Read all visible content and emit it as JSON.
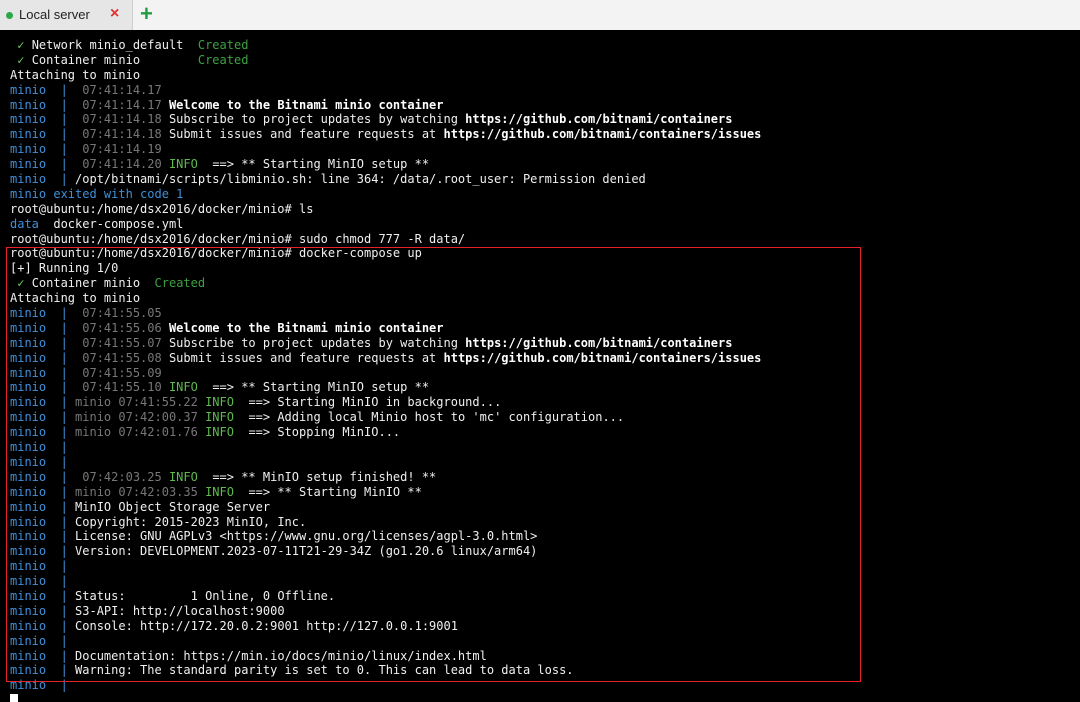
{
  "tab": {
    "title": "Local server",
    "close_icon": "×",
    "add_icon": "+"
  },
  "colors": {
    "highlight_border": "#e8222b",
    "container_prefix": "#3f8fd8",
    "timestamp": "#777777",
    "info": "#5fb94f",
    "created": "#3ea043"
  },
  "terminal": {
    "lines": [
      [
        [
          "check",
          " ✓ "
        ],
        [
          "white",
          "Network minio_default  "
        ],
        [
          "dgreen",
          "Created"
        ]
      ],
      [
        [
          "check",
          " ✓ "
        ],
        [
          "white",
          "Container minio        "
        ],
        [
          "dgreen",
          "Created"
        ]
      ],
      [
        [
          "white",
          "Attaching to minio"
        ]
      ],
      [
        [
          "blue",
          "minio  |  "
        ],
        [
          "dim",
          "07:41:14.17"
        ]
      ],
      [
        [
          "blue",
          "minio  |  "
        ],
        [
          "dim",
          "07:41:14.17 "
        ],
        [
          "bold",
          "Welcome to the Bitnami minio container"
        ]
      ],
      [
        [
          "blue",
          "minio  |  "
        ],
        [
          "dim",
          "07:41:14.18 "
        ],
        [
          "white",
          "Subscribe to project updates by watching "
        ],
        [
          "bold",
          "https://github.com/bitnami/containers"
        ]
      ],
      [
        [
          "blue",
          "minio  |  "
        ],
        [
          "dim",
          "07:41:14.18 "
        ],
        [
          "white",
          "Submit issues and feature requests at "
        ],
        [
          "bold",
          "https://github.com/bitnami/containers/issues"
        ]
      ],
      [
        [
          "blue",
          "minio  |  "
        ],
        [
          "dim",
          "07:41:14.19"
        ]
      ],
      [
        [
          "blue",
          "minio  |  "
        ],
        [
          "dim",
          "07:41:14.20 "
        ],
        [
          "green",
          "INFO  "
        ],
        [
          "white",
          "==> ** Starting MinIO setup **"
        ]
      ],
      [
        [
          "blue",
          "minio  | "
        ],
        [
          "white",
          "/opt/bitnami/scripts/libminio.sh: line 364: /data/.root_user: Permission denied"
        ]
      ],
      [
        [
          "blue",
          "minio exited with code 1"
        ]
      ],
      [
        [
          "white",
          "root@ubuntu:/home/dsx2016/docker/minio# ls"
        ]
      ],
      [
        [
          "blue",
          "data"
        ],
        [
          "white",
          "  docker-compose.yml"
        ]
      ],
      [
        [
          "white",
          "root@ubuntu:/home/dsx2016/docker/minio# sudo chmod 777 -R data/"
        ]
      ],
      [
        [
          "white",
          "root@ubuntu:/home/dsx2016/docker/minio# docker-compose up"
        ]
      ],
      [
        [
          "white",
          "[+] Running 1/0"
        ]
      ],
      [
        [
          "check",
          " ✓ "
        ],
        [
          "white",
          "Container minio  "
        ],
        [
          "dgreen",
          "Created"
        ]
      ],
      [
        [
          "white",
          "Attaching to minio"
        ]
      ],
      [
        [
          "blue",
          "minio  |  "
        ],
        [
          "dim",
          "07:41:55.05"
        ]
      ],
      [
        [
          "blue",
          "minio  |  "
        ],
        [
          "dim",
          "07:41:55.06 "
        ],
        [
          "bold",
          "Welcome to the Bitnami minio container"
        ]
      ],
      [
        [
          "blue",
          "minio  |  "
        ],
        [
          "dim",
          "07:41:55.07 "
        ],
        [
          "white",
          "Subscribe to project updates by watching "
        ],
        [
          "bold",
          "https://github.com/bitnami/containers"
        ]
      ],
      [
        [
          "blue",
          "minio  |  "
        ],
        [
          "dim",
          "07:41:55.08 "
        ],
        [
          "white",
          "Submit issues and feature requests at "
        ],
        [
          "bold",
          "https://github.com/bitnami/containers/issues"
        ]
      ],
      [
        [
          "blue",
          "minio  |  "
        ],
        [
          "dim",
          "07:41:55.09"
        ]
      ],
      [
        [
          "blue",
          "minio  |  "
        ],
        [
          "dim",
          "07:41:55.10 "
        ],
        [
          "green",
          "INFO  "
        ],
        [
          "white",
          "==> ** Starting MinIO setup **"
        ]
      ],
      [
        [
          "blue",
          "minio  | "
        ],
        [
          "dim",
          "minio 07:41:55.22 "
        ],
        [
          "green",
          "INFO  "
        ],
        [
          "white",
          "==> Starting MinIO in background..."
        ]
      ],
      [
        [
          "blue",
          "minio  | "
        ],
        [
          "dim",
          "minio 07:42:00.37 "
        ],
        [
          "green",
          "INFO  "
        ],
        [
          "white",
          "==> Adding local Minio host to 'mc' configuration..."
        ]
      ],
      [
        [
          "blue",
          "minio  | "
        ],
        [
          "dim",
          "minio 07:42:01.76 "
        ],
        [
          "green",
          "INFO  "
        ],
        [
          "white",
          "==> Stopping MinIO..."
        ]
      ],
      [
        [
          "blue",
          "minio  |"
        ]
      ],
      [
        [
          "blue",
          "minio  |"
        ]
      ],
      [
        [
          "blue",
          "minio  |  "
        ],
        [
          "dim",
          "07:42:03.25 "
        ],
        [
          "green",
          "INFO  "
        ],
        [
          "white",
          "==> ** MinIO setup finished! **"
        ]
      ],
      [
        [
          "blue",
          "minio  | "
        ],
        [
          "dim",
          "minio 07:42:03.35 "
        ],
        [
          "green",
          "INFO  "
        ],
        [
          "white",
          "==> ** Starting MinIO **"
        ]
      ],
      [
        [
          "blue",
          "minio  | "
        ],
        [
          "white",
          "MinIO Object Storage Server"
        ]
      ],
      [
        [
          "blue",
          "minio  | "
        ],
        [
          "white",
          "Copyright: 2015-2023 MinIO, Inc."
        ]
      ],
      [
        [
          "blue",
          "minio  | "
        ],
        [
          "white",
          "License: GNU AGPLv3 <https://www.gnu.org/licenses/agpl-3.0.html>"
        ]
      ],
      [
        [
          "blue",
          "minio  | "
        ],
        [
          "white",
          "Version: DEVELOPMENT.2023-07-11T21-29-34Z (go1.20.6 linux/arm64)"
        ]
      ],
      [
        [
          "blue",
          "minio  |"
        ]
      ],
      [
        [
          "blue",
          "minio  |"
        ]
      ],
      [
        [
          "blue",
          "minio  | "
        ],
        [
          "white",
          "Status:         1 Online, 0 Offline."
        ]
      ],
      [
        [
          "blue",
          "minio  | "
        ],
        [
          "white",
          "S3-API: http://localhost:9000"
        ]
      ],
      [
        [
          "blue",
          "minio  | "
        ],
        [
          "white",
          "Console: http://172.20.0.2:9001 http://127.0.0.1:9001"
        ]
      ],
      [
        [
          "blue",
          "minio  |"
        ]
      ],
      [
        [
          "blue",
          "minio  | "
        ],
        [
          "white",
          "Documentation: https://min.io/docs/minio/linux/index.html"
        ]
      ],
      [
        [
          "blue",
          "minio  | "
        ],
        [
          "white",
          "Warning: The standard parity is set to 0. This can lead to data loss."
        ]
      ],
      [
        [
          "blue",
          "minio  |"
        ]
      ]
    ]
  }
}
